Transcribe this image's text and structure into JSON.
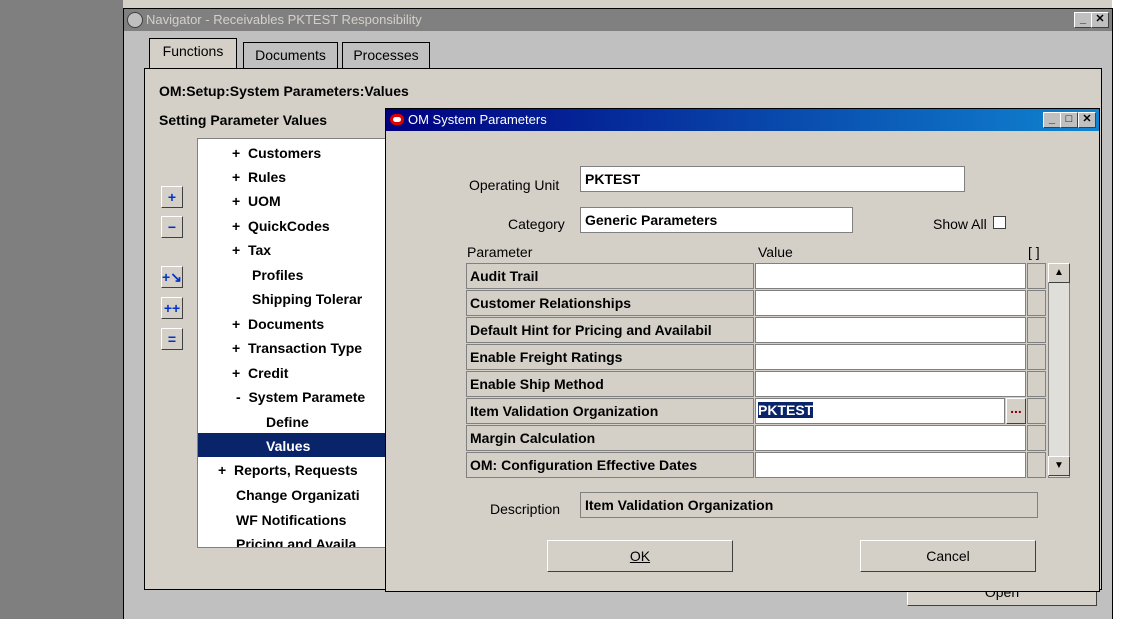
{
  "navigator": {
    "title": "Navigator - Receivables PKTEST Responsibility",
    "tabs": [
      "Functions",
      "Documents",
      "Processes"
    ],
    "path": "OM:Setup:System Parameters:Values",
    "subtitle": "Setting Parameter Values",
    "tree": [
      {
        "prefix": "+",
        "label": "Customers"
      },
      {
        "prefix": "+",
        "label": "Rules"
      },
      {
        "prefix": "+",
        "label": "UOM"
      },
      {
        "prefix": "+",
        "label": "QuickCodes"
      },
      {
        "prefix": "+",
        "label": "Tax"
      },
      {
        "prefix": "",
        "label": "Profiles"
      },
      {
        "prefix": "",
        "label": "Shipping Tolerar"
      },
      {
        "prefix": "+",
        "label": "Documents"
      },
      {
        "prefix": "+",
        "label": "Transaction Type"
      },
      {
        "prefix": "+",
        "label": "Credit"
      },
      {
        "prefix": "-",
        "label": "System Paramete"
      },
      {
        "prefix": "",
        "label": "Define"
      },
      {
        "prefix": "",
        "label": "Values"
      },
      {
        "prefix": "+",
        "label": "Reports, Requests"
      },
      {
        "prefix": "",
        "label": "Change Organizati"
      },
      {
        "prefix": "",
        "label": "WF Notifications"
      },
      {
        "prefix": "",
        "label": "Pricing and Availa"
      }
    ],
    "open_button": "Open"
  },
  "dialog": {
    "title": "OM System Parameters",
    "operating_unit_label": "Operating Unit",
    "operating_unit_value": "PKTEST",
    "category_label": "Category",
    "category_value": "Generic Parameters",
    "show_all_label": "Show All",
    "col_parameter": "Parameter",
    "col_value": "Value",
    "col_marker": "[ ]",
    "rows": [
      {
        "parameter": "Audit Trail",
        "value": ""
      },
      {
        "parameter": "Customer Relationships",
        "value": ""
      },
      {
        "parameter": "Default Hint for Pricing and Availabil",
        "value": ""
      },
      {
        "parameter": "Enable Freight Ratings",
        "value": ""
      },
      {
        "parameter": "Enable Ship Method",
        "value": ""
      },
      {
        "parameter": "Item Validation Organization",
        "value": "PKTEST"
      },
      {
        "parameter": "Margin Calculation",
        "value": ""
      },
      {
        "parameter": "OM:  Configuration Effective Dates",
        "value": ""
      }
    ],
    "lov_button": "...",
    "description_label": "Description",
    "description_value": "Item Validation Organization",
    "ok_button": "OK",
    "cancel_button": "Cancel"
  },
  "colors": {
    "selection": "#0a246a",
    "title_active": "#000080"
  }
}
